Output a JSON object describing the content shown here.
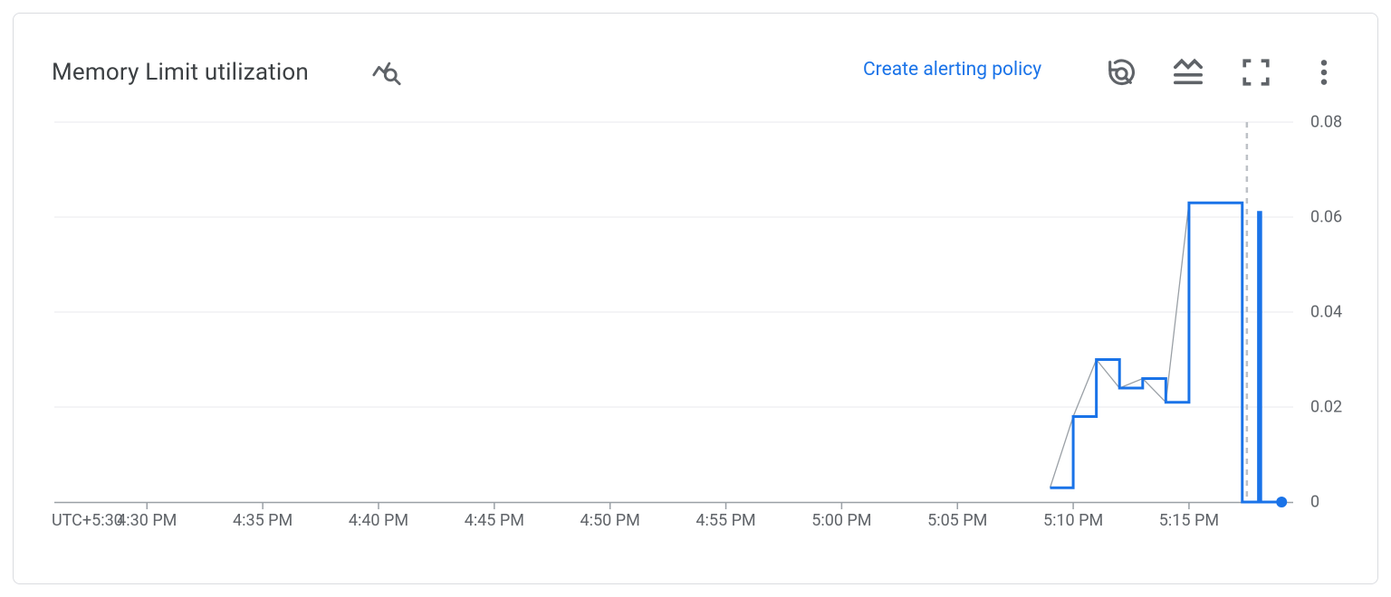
{
  "header": {
    "title": "Memory Limit utilization",
    "alert_link": "Create alerting policy"
  },
  "timezone": "UTC+5:30",
  "chart_data": {
    "type": "line",
    "title": "Memory Limit utilization",
    "xlabel": "",
    "ylabel": "",
    "ylim": [
      0,
      0.08
    ],
    "y_ticks": [
      0,
      0.02,
      0.04,
      0.06,
      0.08
    ],
    "categories": [
      "4:30 PM",
      "4:35 PM",
      "4:40 PM",
      "4:45 PM",
      "4:50 PM",
      "4:55 PM",
      "5:00 PM",
      "5:05 PM",
      "5:10 PM",
      "5:15 PM"
    ],
    "x_minutes": [
      270,
      275,
      280,
      285,
      290,
      295,
      300,
      305,
      310,
      315
    ],
    "x_range_minutes": [
      266,
      319.5
    ],
    "now_marker_minute": 317.5,
    "series": [
      {
        "name": "primary",
        "style": "step",
        "color": "#1a73e8",
        "points": [
          {
            "m": 309.0,
            "v": 0.003
          },
          {
            "m": 310.0,
            "v": 0.018
          },
          {
            "m": 311.0,
            "v": 0.03
          },
          {
            "m": 312.0,
            "v": 0.024
          },
          {
            "m": 313.0,
            "v": 0.026
          },
          {
            "m": 314.0,
            "v": 0.021
          },
          {
            "m": 315.0,
            "v": 0.063
          },
          {
            "m": 317.2,
            "v": 0.063
          },
          {
            "m": 317.3,
            "v": 0.0
          },
          {
            "m": 318.0,
            "v": 0.061
          },
          {
            "m": 318.1,
            "v": 0.0
          },
          {
            "m": 319.0,
            "v": 0.0
          }
        ]
      },
      {
        "name": "secondary",
        "style": "linear",
        "color": "#9aa0a6",
        "points": [
          {
            "m": 309.0,
            "v": 0.003
          },
          {
            "m": 310.0,
            "v": 0.018
          },
          {
            "m": 311.0,
            "v": 0.03
          },
          {
            "m": 312.0,
            "v": 0.024
          },
          {
            "m": 313.0,
            "v": 0.026
          },
          {
            "m": 314.0,
            "v": 0.021
          },
          {
            "m": 315.0,
            "v": 0.063
          },
          {
            "m": 317.2,
            "v": 0.063
          }
        ]
      }
    ]
  }
}
